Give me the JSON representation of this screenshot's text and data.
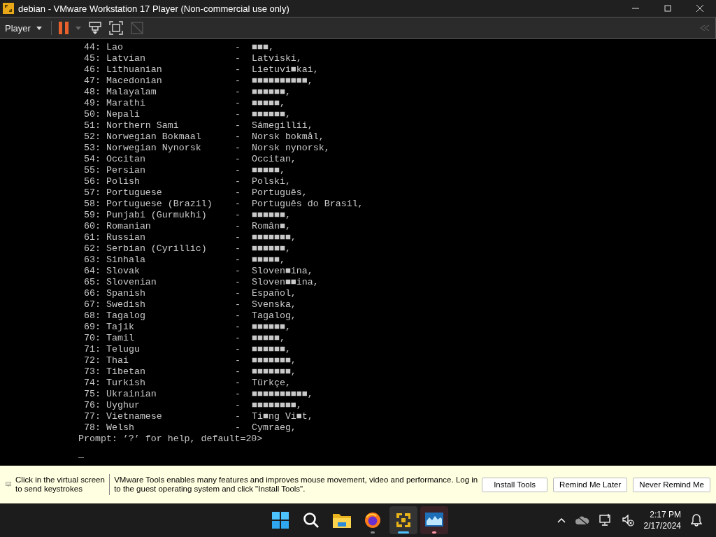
{
  "window": {
    "title": "debian - VMware Workstation 17 Player (Non-commercial use only)"
  },
  "toolbar": {
    "menu": "Player"
  },
  "terminal": {
    "lines": [
      {
        "number": "44:",
        "name": "Lao",
        "separator": "-",
        "native": "■■■,"
      },
      {
        "number": "45:",
        "name": "Latvian",
        "separator": "-",
        "native": "Latviski,"
      },
      {
        "number": "46:",
        "name": "Lithuanian",
        "separator": "-",
        "native": "Lietuvi■kai,"
      },
      {
        "number": "47:",
        "name": "Macedonian",
        "separator": "-",
        "native": "■■■■■■■■■■,"
      },
      {
        "number": "48:",
        "name": "Malayalam",
        "separator": "-",
        "native": "■■■■■■,"
      },
      {
        "number": "49:",
        "name": "Marathi",
        "separator": "-",
        "native": "■■■■■,"
      },
      {
        "number": "50:",
        "name": "Nepali",
        "separator": "-",
        "native": "■■■■■■,"
      },
      {
        "number": "51:",
        "name": "Northern Sami",
        "separator": "-",
        "native": "Sámegillii,"
      },
      {
        "number": "52:",
        "name": "Norwegian Bokmaal",
        "separator": "-",
        "native": "Norsk bokmål,"
      },
      {
        "number": "53:",
        "name": "Norwegian Nynorsk",
        "separator": "-",
        "native": "Norsk nynorsk,"
      },
      {
        "number": "54:",
        "name": "Occitan",
        "separator": "-",
        "native": "Occitan,"
      },
      {
        "number": "55:",
        "name": "Persian",
        "separator": "-",
        "native": "■■■■■,"
      },
      {
        "number": "56:",
        "name": "Polish",
        "separator": "-",
        "native": "Polski,"
      },
      {
        "number": "57:",
        "name": "Portuguese",
        "separator": "-",
        "native": "Português,"
      },
      {
        "number": "58:",
        "name": "Portuguese (Brazil)",
        "separator": "-",
        "native": "Português do Brasil,"
      },
      {
        "number": "59:",
        "name": "Punjabi (Gurmukhi)",
        "separator": "-",
        "native": "■■■■■■,"
      },
      {
        "number": "60:",
        "name": "Romanian",
        "separator": "-",
        "native": "Român■,"
      },
      {
        "number": "61:",
        "name": "Russian",
        "separator": "-",
        "native": "■■■■■■■,"
      },
      {
        "number": "62:",
        "name": "Serbian (Cyrillic)",
        "separator": "-",
        "native": "■■■■■■,"
      },
      {
        "number": "63:",
        "name": "Sinhala",
        "separator": "-",
        "native": "■■■■■,"
      },
      {
        "number": "64:",
        "name": "Slovak",
        "separator": "-",
        "native": "Sloven■ina,"
      },
      {
        "number": "65:",
        "name": "Slovenian",
        "separator": "-",
        "native": "Sloven■■ina,"
      },
      {
        "number": "66:",
        "name": "Spanish",
        "separator": "-",
        "native": "Español,"
      },
      {
        "number": "67:",
        "name": "Swedish",
        "separator": "-",
        "native": "Svenska,"
      },
      {
        "number": "68:",
        "name": "Tagalog",
        "separator": "-",
        "native": "Tagalog,"
      },
      {
        "number": "69:",
        "name": "Tajik",
        "separator": "-",
        "native": "■■■■■■,"
      },
      {
        "number": "70:",
        "name": "Tamil",
        "separator": "-",
        "native": "■■■■■,"
      },
      {
        "number": "71:",
        "name": "Telugu",
        "separator": "-",
        "native": "■■■■■■,"
      },
      {
        "number": "72:",
        "name": "Thai",
        "separator": "-",
        "native": "■■■■■■■,"
      },
      {
        "number": "73:",
        "name": "Tibetan",
        "separator": "-",
        "native": "■■■■■■■,"
      },
      {
        "number": "74:",
        "name": "Turkish",
        "separator": "-",
        "native": "Türkçe,"
      },
      {
        "number": "75:",
        "name": "Ukrainian",
        "separator": "-",
        "native": "■■■■■■■■■■,"
      },
      {
        "number": "76:",
        "name": "Uyghur",
        "separator": "-",
        "native": "■■■■■■■■,"
      },
      {
        "number": "77:",
        "name": "Vietnamese",
        "separator": "-",
        "native": "Ti■ng Vi■t,"
      },
      {
        "number": "78:",
        "name": "Welsh",
        "separator": "-",
        "native": "Cymraeg,"
      }
    ],
    "prompt": "Prompt: ’?’ for help, default=20>",
    "cursor": "_"
  },
  "notification": {
    "hint": "Click in the virtual screen to send keystrokes",
    "message": "VMware Tools enables many features and improves mouse movement, video and performance. Log in to the guest operating system and click \"Install Tools\".",
    "buttons": [
      "Install Tools",
      "Remind Me Later",
      "Never Remind Me"
    ]
  },
  "taskbar": {
    "apps": [
      {
        "kind": "start",
        "selected": false,
        "running": false,
        "attention": false
      },
      {
        "kind": "search",
        "selected": false,
        "running": false,
        "attention": false
      },
      {
        "kind": "folder",
        "selected": false,
        "running": false,
        "attention": false
      },
      {
        "kind": "browser",
        "selected": false,
        "running": true,
        "attention": false
      },
      {
        "kind": "vmware",
        "selected": true,
        "running": true,
        "attention": false
      },
      {
        "kind": "monitor",
        "selected": false,
        "running": true,
        "attention": true
      }
    ],
    "time": "2:17 PM",
    "date": "2/17/2024"
  }
}
